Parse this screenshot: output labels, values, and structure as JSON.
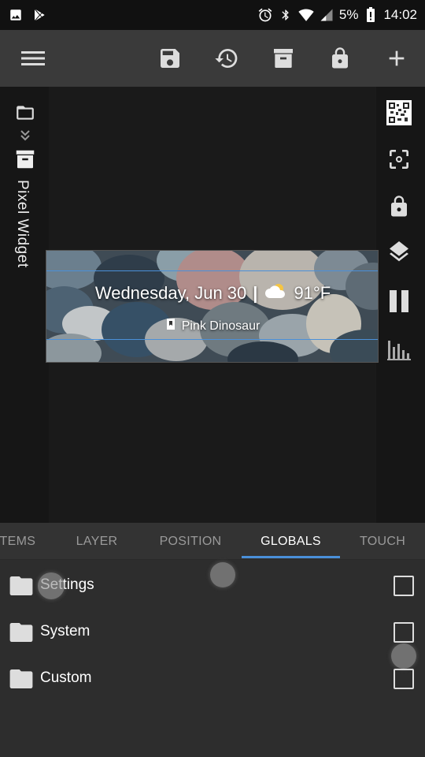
{
  "status_bar": {
    "left_icons": [
      "image-icon",
      "play-store-icon"
    ],
    "right_icons": [
      "alarm-icon",
      "bluetooth-icon",
      "wifi-icon",
      "signal-icon",
      "battery-icon"
    ],
    "battery": "5%",
    "time": "14:02"
  },
  "toolbar": {
    "buttons": [
      "menu-icon",
      "save-icon",
      "history-icon",
      "archive-icon",
      "lock-icon",
      "add-icon"
    ]
  },
  "editor": {
    "title": "Pixel Widget",
    "left_icons": [
      "folder-open-icon",
      "expand-icon",
      "archive-icon"
    ],
    "right_icons": [
      "qr-code-icon",
      "focus-icon",
      "lock-icon",
      "layers-icon",
      "pause-icon",
      "equalizer-icon"
    ]
  },
  "widget": {
    "date": "Wednesday, Jun 30",
    "separator": "|",
    "temperature": "91°F",
    "event": "Pink Dinosaur"
  },
  "tabs": [
    {
      "label": "ITEMS",
      "active": false
    },
    {
      "label": "LAYER",
      "active": false
    },
    {
      "label": "POSITION",
      "active": false
    },
    {
      "label": "GLOBALS",
      "active": true
    },
    {
      "label": "TOUCH",
      "active": false
    }
  ],
  "globals": [
    {
      "label": "Settings",
      "checked": false
    },
    {
      "label": "System",
      "checked": false
    },
    {
      "label": "Custom",
      "checked": false
    }
  ],
  "colors": {
    "accent": "#4a90d9",
    "toolbar": "#3a3a3a",
    "background": "#2d2d2d",
    "status_bar": "#111111"
  }
}
